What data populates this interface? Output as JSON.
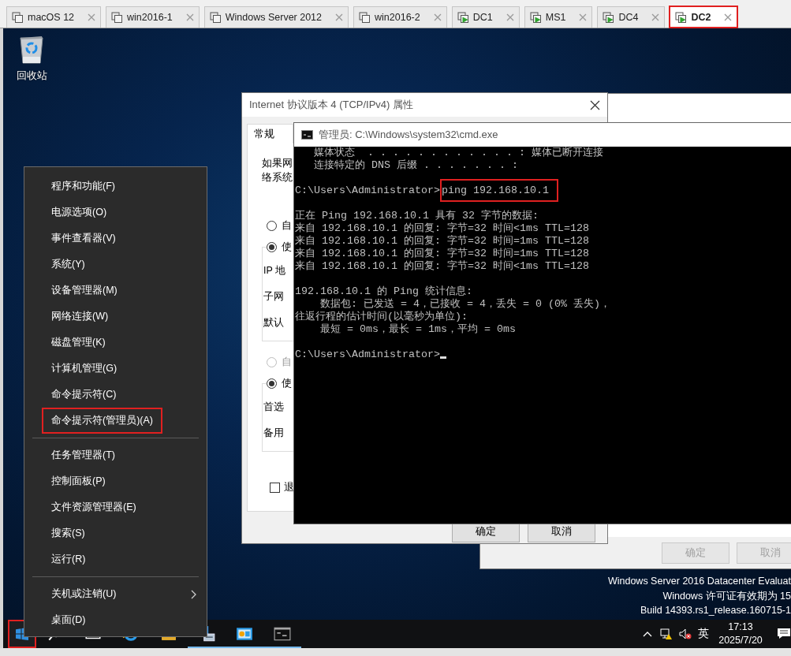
{
  "vm_tabs": [
    {
      "label": "macOS 12",
      "running": false,
      "selected": false,
      "highlighted": false
    },
    {
      "label": "win2016-1",
      "running": false,
      "selected": false,
      "highlighted": false
    },
    {
      "label": "Windows Server 2012",
      "running": false,
      "selected": false,
      "highlighted": false
    },
    {
      "label": "win2016-2",
      "running": false,
      "selected": false,
      "highlighted": false
    },
    {
      "label": "DC1",
      "running": true,
      "selected": false,
      "highlighted": false
    },
    {
      "label": "MS1",
      "running": true,
      "selected": false,
      "highlighted": false
    },
    {
      "label": "DC4",
      "running": true,
      "selected": false,
      "highlighted": false
    },
    {
      "label": "DC2",
      "running": true,
      "selected": true,
      "highlighted": true
    }
  ],
  "desktop": {
    "icons": [
      {
        "kind": "recycle_bin",
        "label": "回收站"
      }
    ]
  },
  "background_dialog": {
    "buttons": [
      {
        "label": "确定",
        "disabled": true
      },
      {
        "label": "取消",
        "disabled": true
      }
    ]
  },
  "ipv4_dialog": {
    "title": "Internet 协议版本 4 (TCP/IPv4) 属性",
    "tabs": [
      {
        "label": "常规",
        "selected": true
      }
    ],
    "intro_lines": [
      "如果网",
      "络系统"
    ],
    "sections": [
      {
        "radios": [
          {
            "label": "自",
            "selected": false,
            "disabled": false
          },
          {
            "label": "使",
            "selected": true,
            "disabled": false
          }
        ],
        "fields": [
          "IP 地",
          "子网",
          "默认"
        ]
      },
      {
        "radios": [
          {
            "label": "自",
            "selected": false,
            "disabled": true
          },
          {
            "label": "使",
            "selected": true,
            "disabled": false
          }
        ],
        "fields": [
          "首选",
          "备用"
        ]
      }
    ],
    "checkbox": {
      "label": "退",
      "checked": false
    },
    "buttons": [
      {
        "label": "确定"
      },
      {
        "label": "取消"
      }
    ]
  },
  "cmd_window": {
    "title": "管理员: C:\\Windows\\system32\\cmd.exe",
    "blocks": [
      {
        "lines": [
          {
            "kind": "text",
            "text": "   媒体状态  . . . . . . . . . . . . : 媒体已断开连接"
          },
          {
            "kind": "text",
            "text": "   连接特定的 DNS 后缀 . . . . . . . :"
          }
        ]
      },
      {
        "lines": [
          {
            "kind": "prompt",
            "prompt": "C:\\Users\\Administrator>",
            "command": "ping 192.168.10.1",
            "highlighted": true
          }
        ]
      },
      {
        "lines": [
          {
            "kind": "text",
            "text": "正在 Ping 192.168.10.1 具有 32 字节的数据:"
          },
          {
            "kind": "text",
            "text": "来自 192.168.10.1 的回复: 字节=32 时间<1ms TTL=128"
          },
          {
            "kind": "text",
            "text": "来自 192.168.10.1 的回复: 字节=32 时间=1ms TTL=128"
          },
          {
            "kind": "text",
            "text": "来自 192.168.10.1 的回复: 字节=32 时间=1ms TTL=128"
          },
          {
            "kind": "text",
            "text": "来自 192.168.10.1 的回复: 字节=32 时间<1ms TTL=128"
          }
        ]
      },
      {
        "lines": [
          {
            "kind": "text",
            "text": "192.168.10.1 的 Ping 统计信息:"
          },
          {
            "kind": "text",
            "text": "    数据包: 已发送 = 4，已接收 = 4，丢失 = 0 (0% 丢失)，"
          },
          {
            "kind": "text",
            "text": "往返行程的估计时间(以毫秒为单位):"
          },
          {
            "kind": "text",
            "text": "    最短 = 0ms，最长 = 1ms，平均 = 0ms"
          }
        ]
      },
      {
        "lines": [
          {
            "kind": "prompt",
            "prompt": "C:\\Users\\Administrator>",
            "cursor": true
          }
        ]
      }
    ]
  },
  "start_menu": {
    "groups": [
      {
        "items": [
          {
            "label": "程序和功能(F)",
            "highlighted": false,
            "submenu": false
          },
          {
            "label": "电源选项(O)",
            "highlighted": false,
            "submenu": false
          },
          {
            "label": "事件查看器(V)",
            "highlighted": false,
            "submenu": false
          },
          {
            "label": "系统(Y)",
            "highlighted": false,
            "submenu": false
          },
          {
            "label": "设备管理器(M)",
            "highlighted": false,
            "submenu": false
          },
          {
            "label": "网络连接(W)",
            "highlighted": false,
            "submenu": false
          },
          {
            "label": "磁盘管理(K)",
            "highlighted": false,
            "submenu": false
          },
          {
            "label": "计算机管理(G)",
            "highlighted": false,
            "submenu": false
          },
          {
            "label": "命令提示符(C)",
            "highlighted": false,
            "submenu": false
          },
          {
            "label": "命令提示符(管理员)(A)",
            "highlighted": true,
            "submenu": false
          }
        ]
      },
      {
        "items": [
          {
            "label": "任务管理器(T)",
            "highlighted": false,
            "submenu": false
          },
          {
            "label": "控制面板(P)",
            "highlighted": false,
            "submenu": false
          },
          {
            "label": "文件资源管理器(E)",
            "highlighted": false,
            "submenu": false
          },
          {
            "label": "搜索(S)",
            "highlighted": false,
            "submenu": false
          },
          {
            "label": "运行(R)",
            "highlighted": false,
            "submenu": false
          }
        ]
      },
      {
        "items": [
          {
            "label": "关机或注销(U)",
            "highlighted": false,
            "submenu": true
          },
          {
            "label": "桌面(D)",
            "highlighted": false,
            "submenu": false
          }
        ]
      }
    ]
  },
  "os_info": [
    "Windows Server 2016 Datacenter Evaluat",
    "Windows 许可证有效期为 15",
    "Build 14393.rs1_release.160715-1"
  ],
  "taskbar": {
    "start_button": {
      "highlighted": true
    },
    "apps": [
      {
        "kind": "search",
        "open": false
      },
      {
        "kind": "task_view",
        "open": false
      },
      {
        "kind": "browser",
        "open": false
      },
      {
        "kind": "folder",
        "open": false
      },
      {
        "kind": "server",
        "open": true
      },
      {
        "kind": "dashboard",
        "open": true
      },
      {
        "kind": "terminal",
        "open": true
      }
    ],
    "tray": {
      "input_method": "英",
      "time": "17:13",
      "date": "2025/7/20"
    }
  }
}
